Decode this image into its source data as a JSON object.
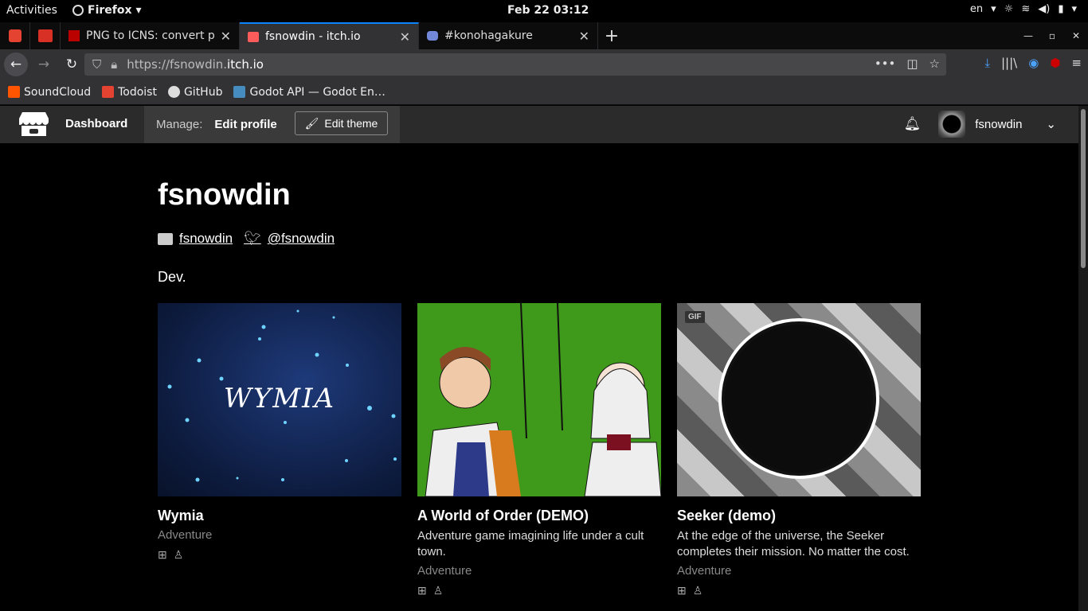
{
  "gnome": {
    "activities": "Activities",
    "app": "Firefox",
    "clock": "Feb 22  03:12",
    "lang": "en"
  },
  "tabs": [
    {
      "title": "PNG to ICNS: convert png",
      "active": false
    },
    {
      "title": "fsnowdin - itch.io",
      "active": true
    },
    {
      "title": "#konohagakure",
      "active": false
    }
  ],
  "url": {
    "prefix": "https://fsnowdin.",
    "host": "itch.io"
  },
  "bookmarks": [
    "SoundCloud",
    "Todoist",
    "GitHub",
    "Godot API — Godot En…"
  ],
  "itch": {
    "dashboard": "Dashboard",
    "manage": "Manage:",
    "edit_profile": "Edit profile",
    "edit_theme": "Edit theme",
    "username": "fsnowdin"
  },
  "profile": {
    "name": "fsnowdin",
    "itch_link": "fsnowdin",
    "twitter": "@fsnowdin",
    "bio": "Dev."
  },
  "games": [
    {
      "title": "Wymia",
      "desc": "",
      "genre": "Adventure",
      "cover_text": "WYMIA"
    },
    {
      "title": "A World of Order (DEMO)",
      "desc": "Adventure game imagining life under a cult town.",
      "genre": "Adventure"
    },
    {
      "title": "Seeker (demo)",
      "desc": "At the edge of the universe, the Seeker completes their mission. No matter the cost.",
      "genre": "Adventure",
      "badge": "GIF"
    }
  ],
  "colors": {
    "accent": "#0a84ff",
    "itch_header": "#2b2b2b"
  }
}
